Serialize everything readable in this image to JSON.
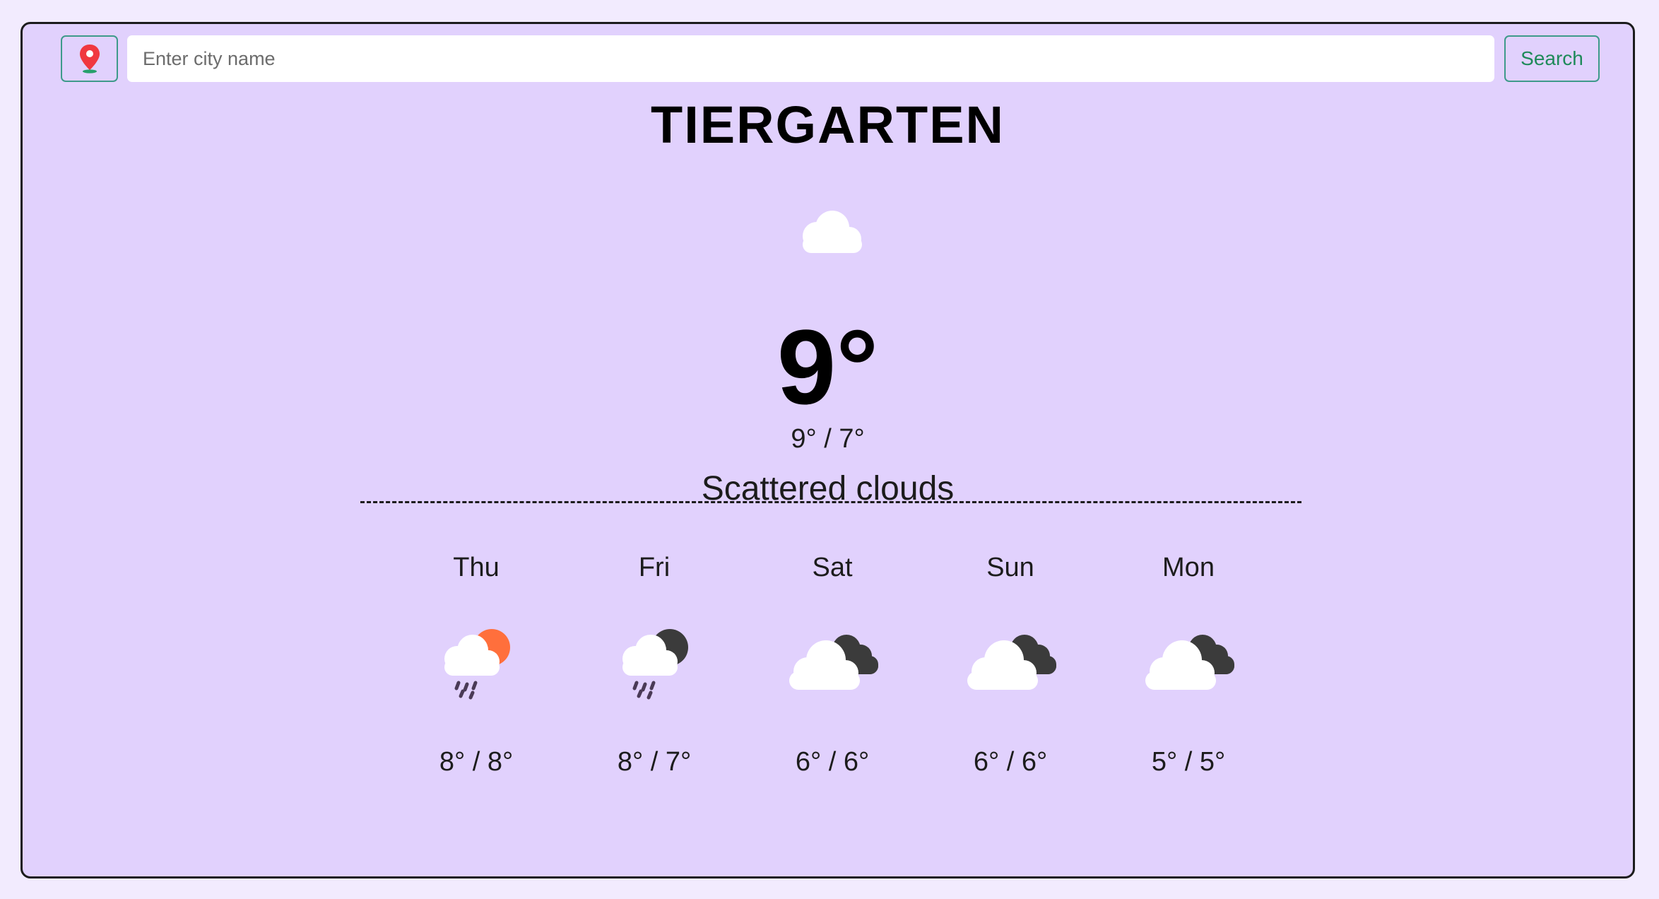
{
  "search": {
    "placeholder": "Enter city name",
    "button_label": "Search",
    "location_icon": "map-pin-icon"
  },
  "current": {
    "city": "TIERGARTEN",
    "icon": "cloud-icon",
    "temperature": "9°",
    "high_low": "9° / 7°",
    "description": "Scattered clouds"
  },
  "forecast": [
    {
      "day": "Thu",
      "icon": "rain-sun-cloud-icon",
      "temps": "8° / 8°"
    },
    {
      "day": "Fri",
      "icon": "rain-moon-cloud-icon",
      "temps": "8° / 7°"
    },
    {
      "day": "Sat",
      "icon": "dark-clouds-icon",
      "temps": "6° / 6°"
    },
    {
      "day": "Sun",
      "icon": "dark-clouds-icon",
      "temps": "6° / 6°"
    },
    {
      "day": "Mon",
      "icon": "dark-clouds-icon",
      "temps": "5° / 5°"
    }
  ],
  "colors": {
    "page_bg": "#f2ebfe",
    "card_bg": "#e1d1fd",
    "accent": "#3e9a8a",
    "search_text": "#1f8a5a",
    "pin": "#f0383f",
    "sun": "#ff6f3c",
    "dark_cloud": "#3b3b3b"
  }
}
